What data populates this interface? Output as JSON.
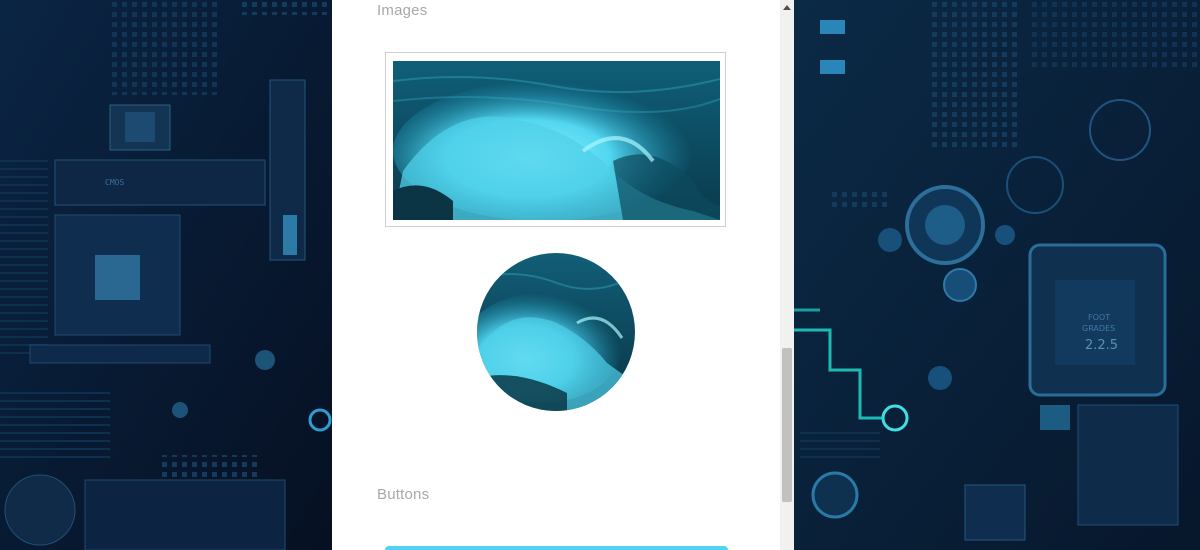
{
  "sections": {
    "images_title": "Images",
    "buttons_title": "Buttons"
  },
  "images": [
    {
      "name": "ocean-wave-thumbnail",
      "style": "thumbnail"
    },
    {
      "name": "ocean-wave-circle",
      "style": "rounded-circle"
    }
  ],
  "buttons": [
    {
      "label": ""
    }
  ],
  "background": {
    "left_chip_text": "CMOS",
    "right_chip_text_1": "FOOT",
    "right_chip_text_2": "GRADES",
    "right_chip_version": "2.2.5"
  },
  "colors": {
    "accent": "#4fd3ee",
    "section_title": "#a8a8a8",
    "panel_bg": "#ffffff",
    "page_bg": "#06162e"
  }
}
